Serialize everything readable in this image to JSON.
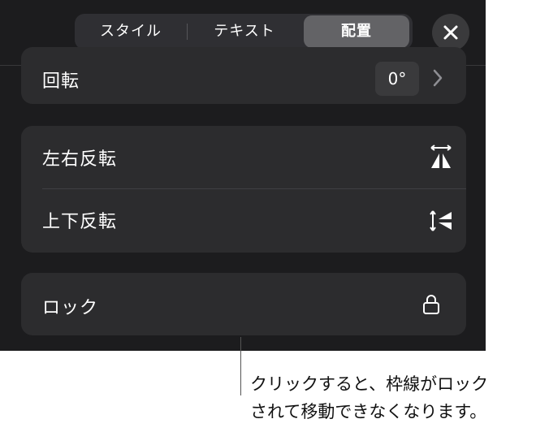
{
  "tabs": {
    "style_label": "スタイル",
    "text_label": "テキスト",
    "arrange_label": "配置",
    "selected": "配置"
  },
  "close": {
    "icon": "close-icon"
  },
  "rotate": {
    "label": "回転",
    "value": "0°",
    "chevron_icon": "chevron-right-icon"
  },
  "flip": {
    "horizontal_label": "左右反転",
    "horizontal_icon": "flip-horizontal-icon",
    "vertical_label": "上下反転",
    "vertical_icon": "flip-vertical-icon"
  },
  "lock": {
    "label": "ロック",
    "icon": "lock-icon"
  },
  "callout": {
    "line1": "クリックすると、枠線がロック",
    "line2": "されて移動できなくなります。"
  },
  "colors": {
    "panel_bg": "#1c1c1e",
    "group_bg": "#2c2c2e",
    "selected_tab_bg": "#636366",
    "text": "#ffffff"
  }
}
